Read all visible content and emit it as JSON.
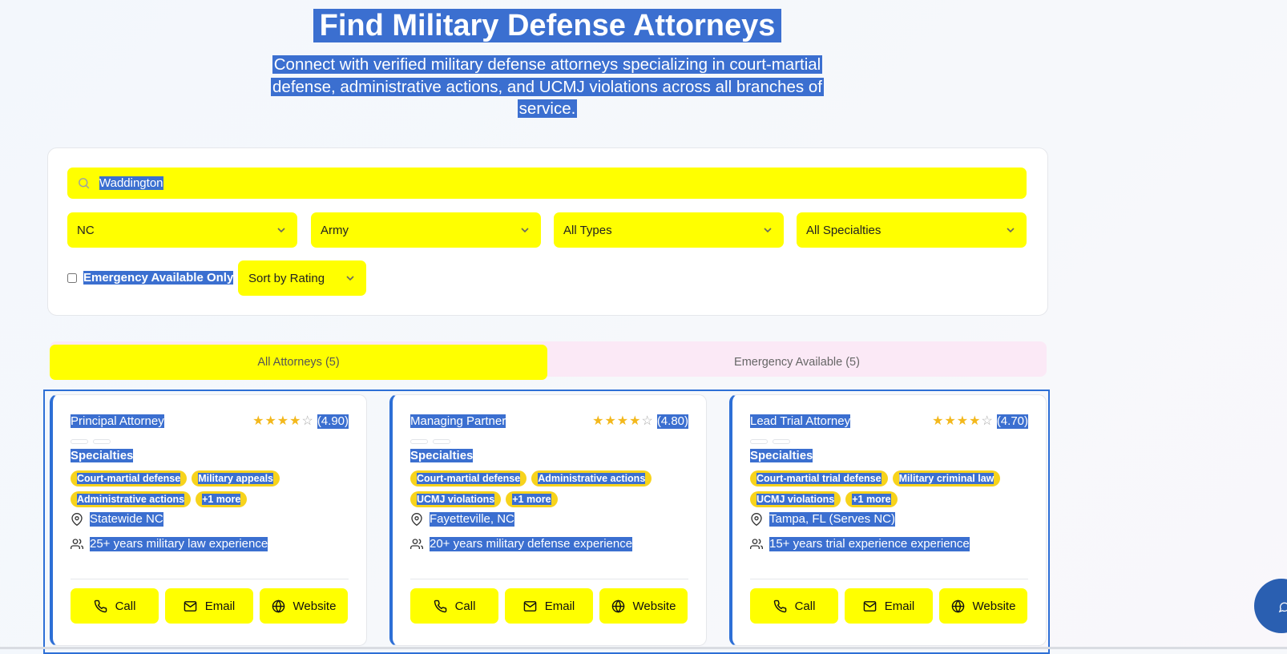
{
  "header": {
    "title": "Find Military Defense Attorneys",
    "subtitle_lines": [
      "Connect with verified military defense attorneys specializing in court-martial",
      "defense, administrative actions, and UCMJ violations across all branches of",
      "service."
    ]
  },
  "search": {
    "value": "Waddington",
    "icon": "search-icon"
  },
  "filters": {
    "state": "NC",
    "branch": "Army",
    "type": "All Types",
    "specialty": "All Specialties",
    "emergency_label": "Emergency Available Only",
    "emergency_checked": false,
    "sort": "Sort by Rating"
  },
  "tabs": [
    {
      "label": "All Attorneys (5)",
      "active": true
    },
    {
      "label": "Emergency Available (5)",
      "active": false
    }
  ],
  "cards": [
    {
      "title": "Principal Attorney",
      "rating_text": "(4.90)",
      "rating": 4.9,
      "specialties_label": "Specialties",
      "chips": [
        "Court-martial defense",
        "Military appeals",
        "Administrative actions",
        "+1 more"
      ],
      "location": "Statewide NC",
      "experience": "25+ years military law experience",
      "buttons": [
        "Call",
        "Email",
        "Website"
      ]
    },
    {
      "title": "Managing Partner",
      "rating_text": "(4.80)",
      "rating": 4.8,
      "specialties_label": "Specialties",
      "chips": [
        "Court-martial defense",
        "Administrative actions",
        "UCMJ violations",
        "+1 more"
      ],
      "location": "Fayetteville, NC",
      "experience": "20+ years military defense experience",
      "buttons": [
        "Call",
        "Email",
        "Website"
      ]
    },
    {
      "title": "Lead Trial Attorney",
      "rating_text": "(4.70)",
      "rating": 4.7,
      "specialties_label": "Specialties",
      "chips": [
        "Court-martial trial defense",
        "Military criminal law",
        "UCMJ violations",
        "+1 more"
      ],
      "location": "Tampa, FL (Serves NC)",
      "experience": "15+ years trial experience experience",
      "buttons": [
        "Call",
        "Email",
        "Website"
      ]
    }
  ],
  "colors": {
    "highlight_yellow": "#ffff00",
    "chip_yellow": "#f7d31c",
    "selection_blue": "#3b6fd0",
    "card_accent": "#2d6fd6",
    "chat_button": "#2a5fb1"
  }
}
